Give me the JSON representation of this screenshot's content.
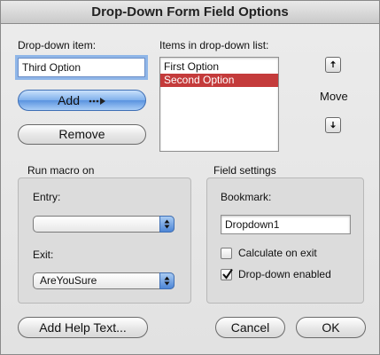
{
  "window": {
    "title": "Drop-Down Form Field Options"
  },
  "dropdown_item": {
    "label": "Drop-down item:",
    "value": "Third Option"
  },
  "buttons": {
    "add": "Add",
    "remove": "Remove",
    "add_help_text": "Add Help Text...",
    "cancel": "Cancel",
    "ok": "OK"
  },
  "items_list": {
    "label": "Items in drop-down list:",
    "items": [
      "First Option",
      "Second Option"
    ],
    "selected_index": 1
  },
  "move": {
    "label": "Move"
  },
  "run_macro": {
    "label": "Run macro on",
    "entry_label": "Entry:",
    "entry_value": "",
    "exit_label": "Exit:",
    "exit_value": "AreYouSure"
  },
  "field_settings": {
    "label": "Field settings",
    "bookmark_label": "Bookmark:",
    "bookmark_value": "Dropdown1",
    "calculate_on_exit": {
      "label": "Calculate on exit",
      "checked": false
    },
    "dropdown_enabled": {
      "label": "Drop-down enabled",
      "checked": true
    }
  },
  "colors": {
    "selection": "#c43b3b",
    "default_button": "#5a93e0",
    "focus_ring": "#8fb6e8"
  },
  "icons": [
    "move-up-arrow-icon",
    "move-down-arrow-icon",
    "add-arrow-icon",
    "popup-arrows-icon",
    "checkmark-icon"
  ]
}
